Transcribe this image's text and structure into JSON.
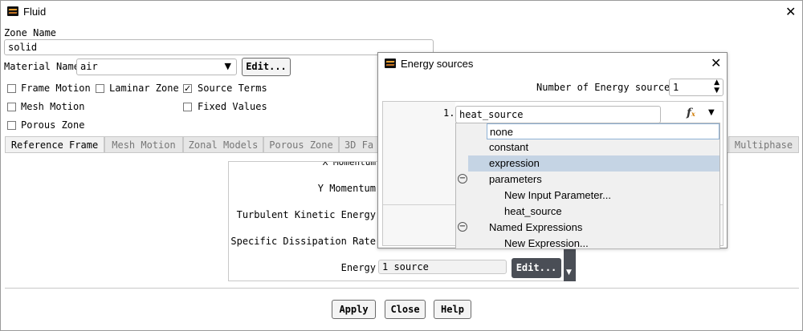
{
  "window": {
    "title": "Fluid",
    "logo_icon": "ansys-logo-icon",
    "close_icon": "close-icon",
    "zone_name_label": "Zone Name",
    "zone_name_value": "solid",
    "material_label": "Material Name",
    "material_value": "air",
    "material_edit": "Edit...",
    "options": {
      "frame_motion": "Frame Motion",
      "laminar_zone": "Laminar Zone",
      "source_terms": "Source Terms",
      "fixed_values": "Fixed Values",
      "mesh_motion": "Mesh Motion",
      "porous_zone": "Porous Zone",
      "source_terms_checked": true
    },
    "tabs": [
      "Reference Frame",
      "Mesh Motion",
      "Zonal Models",
      "Porous Zone",
      "3D Fa",
      "Multiphase"
    ],
    "source_rows": {
      "partial_top": "X Momentum",
      "y_momentum": "Y Momentum",
      "tke": "Turbulent Kinetic Energy",
      "sdr": "Specific Dissipation Rate",
      "energy": "Energy",
      "energy_value": "1 source",
      "energy_edit": "Edit..."
    },
    "buttons": {
      "apply": "Apply",
      "close": "Close",
      "help": "Help"
    }
  },
  "energy_dialog": {
    "title": "Energy sources",
    "count_label": "Number of Energy sources",
    "count_value": "1",
    "row_index": "1.",
    "row_value": "heat_source",
    "fx_icon": "function-icon",
    "dropdown_icon": "caret-down-icon"
  },
  "dropdown": {
    "items": [
      {
        "label": "none",
        "level": 0,
        "state": "current"
      },
      {
        "label": "constant",
        "level": 0,
        "state": ""
      },
      {
        "label": "expression",
        "level": 0,
        "state": "hover"
      },
      {
        "label": "parameters",
        "level": 0,
        "state": "group"
      },
      {
        "label": "New Input Parameter...",
        "level": 1,
        "state": ""
      },
      {
        "label": "heat_source",
        "level": 1,
        "state": ""
      },
      {
        "label": "Named Expressions",
        "level": 0,
        "state": "group"
      },
      {
        "label": "New Expression...",
        "level": 1,
        "state": ""
      }
    ]
  },
  "colors": {
    "hover": "#c5d4e4",
    "current_border": "#8fb2d6",
    "dark_button": "#4a4e56"
  }
}
